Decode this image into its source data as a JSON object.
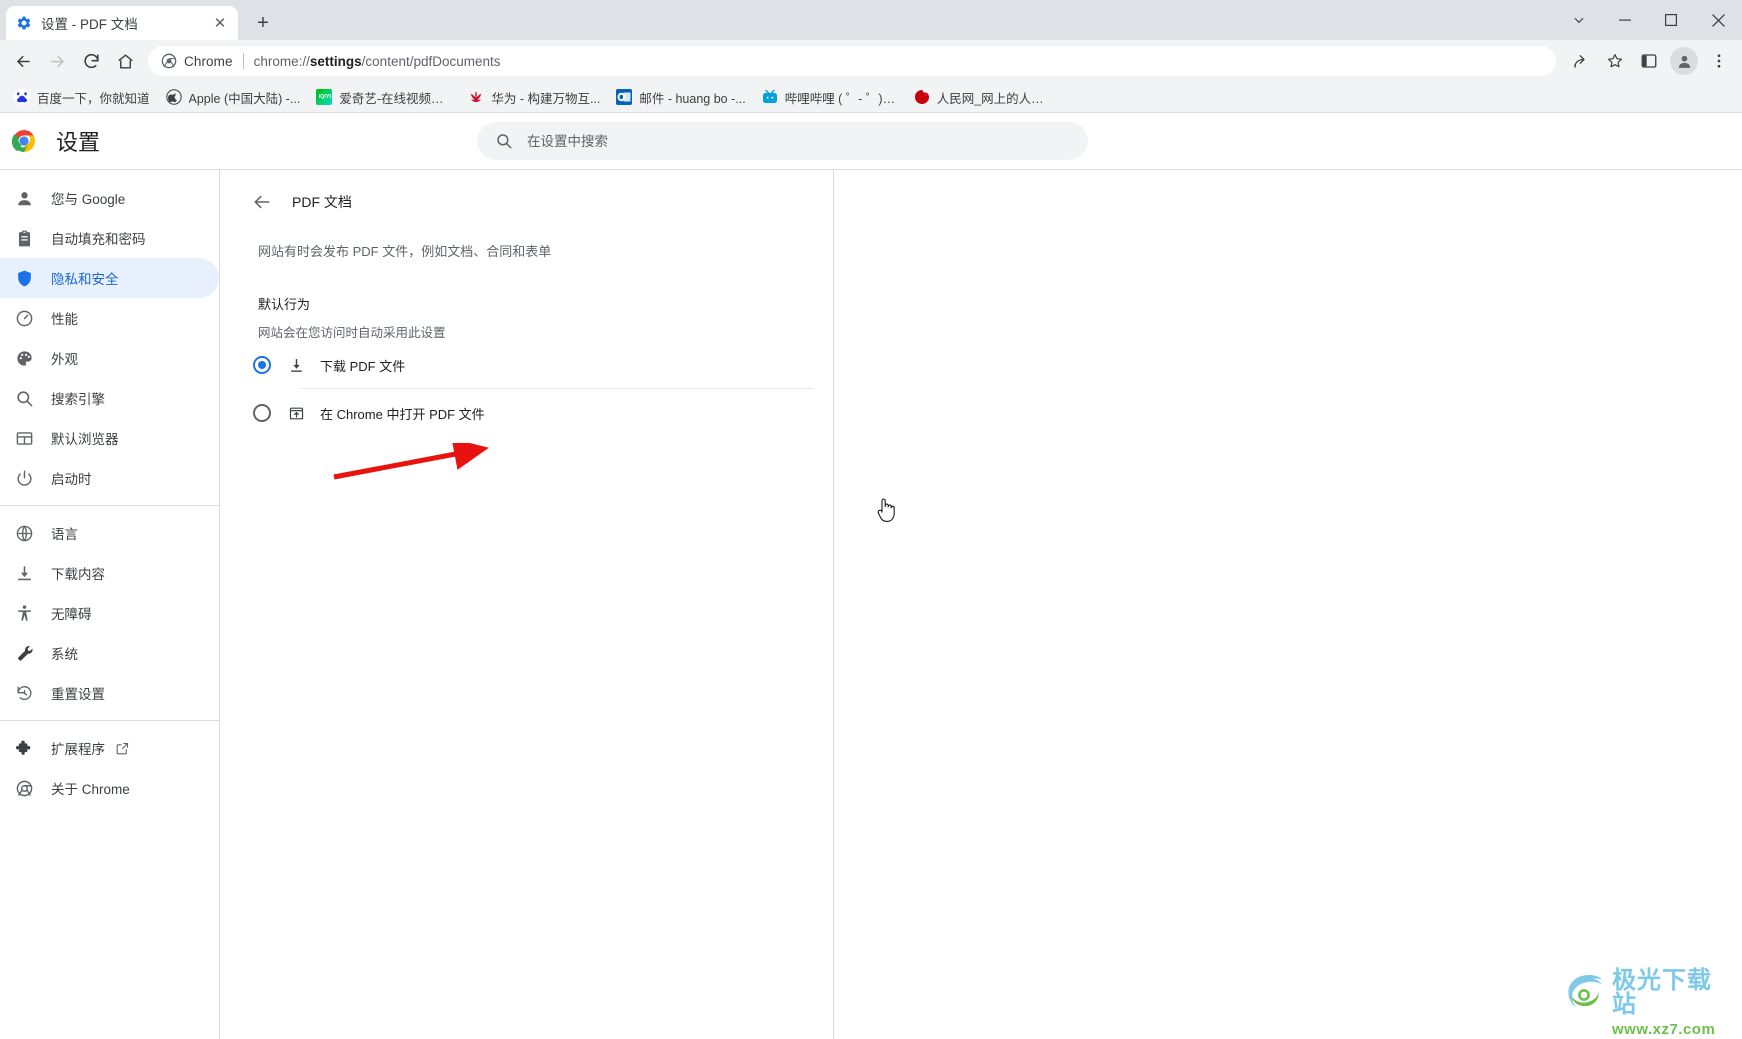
{
  "window": {
    "tab": {
      "title": "设置 - PDF 文档",
      "favicon": "gear-icon",
      "close_label": "✕"
    },
    "new_tab_label": "+",
    "controls": {
      "tab_search_label": "⌄",
      "minimize_label": "—",
      "maximize_label": "□",
      "close_label": "✕"
    }
  },
  "toolbar": {
    "back_label": "←",
    "forward_label": "→",
    "reload_label": "⟳",
    "home_label": "⌂",
    "omnibox": {
      "chip_label": "Chrome",
      "url_prefix": "chrome://",
      "url_bold": "settings",
      "url_suffix": "/content/pdfDocuments"
    },
    "share_icon": "share-icon",
    "bookmark_icon": "star-icon",
    "sidepanel_icon": "side-panel-icon",
    "profile_icon": "avatar-icon",
    "menu_icon": "three-dot-menu-icon"
  },
  "bookmarks": [
    {
      "label": "百度一下，你就知道",
      "icon": "baidu-icon",
      "glyph": "百",
      "bg": "#3385ff",
      "fg": "#ffffff"
    },
    {
      "label": "Apple (中国大陆) -...",
      "icon": "apple-icon",
      "glyph": "",
      "bg": "#555555",
      "fg": "#ffffff"
    },
    {
      "label": "爱奇艺-在线视频网...",
      "icon": "iqiyi-icon",
      "glyph": "iQIYI",
      "bg": "#00be06",
      "fg": "#ffffff"
    },
    {
      "label": "华为 - 构建万物互...",
      "icon": "huawei-icon",
      "glyph": "",
      "bg": "#ffffff",
      "fg": "#cf0a2c"
    },
    {
      "label": "邮件 - huang bo -...",
      "icon": "outlook-icon",
      "glyph": "O",
      "bg": "#0364b8",
      "fg": "#ffffff"
    },
    {
      "label": "哔哩哔哩 ( ゜- ゜)つ...",
      "icon": "bilibili-icon",
      "glyph": "",
      "bg": "#ffffff",
      "fg": "#00a1d6"
    },
    {
      "label": "人民网_网上的人民...",
      "icon": "people-icon",
      "glyph": "",
      "bg": "#ffffff",
      "fg": "#c7000b"
    }
  ],
  "settings": {
    "logo_icon": "chrome-logo-icon",
    "title": "设置",
    "search": {
      "icon": "search-icon",
      "placeholder": "在设置中搜索",
      "value": ""
    },
    "sidebar_groups": [
      {
        "items": [
          {
            "label": "您与 Google",
            "icon": "person-icon",
            "active": false
          },
          {
            "label": "自动填充和密码",
            "icon": "clipboard-icon",
            "active": false
          },
          {
            "label": "隐私和安全",
            "icon": "shield-icon",
            "active": true
          },
          {
            "label": "性能",
            "icon": "speedometer-icon",
            "active": false
          },
          {
            "label": "外观",
            "icon": "palette-icon",
            "active": false
          },
          {
            "label": "搜索引擎",
            "icon": "search-icon",
            "active": false
          },
          {
            "label": "默认浏览器",
            "icon": "browser-window-icon",
            "active": false
          },
          {
            "label": "启动时",
            "icon": "power-icon",
            "active": false
          }
        ]
      },
      {
        "items": [
          {
            "label": "语言",
            "icon": "globe-icon",
            "active": false
          },
          {
            "label": "下载内容",
            "icon": "download-icon",
            "active": false
          },
          {
            "label": "无障碍",
            "icon": "accessibility-icon",
            "active": false
          },
          {
            "label": "系统",
            "icon": "wrench-icon",
            "active": false
          },
          {
            "label": "重置设置",
            "icon": "history-restore-icon",
            "active": false
          }
        ]
      },
      {
        "items": [
          {
            "label": "扩展程序",
            "icon": "puzzle-icon",
            "active": false,
            "external": true
          },
          {
            "label": "关于 Chrome",
            "icon": "chrome-icon",
            "active": false
          }
        ]
      }
    ],
    "detail": {
      "back_icon": "back-arrow-icon",
      "title": "PDF 文档",
      "description": "网站有时会发布 PDF 文件，例如文档、合同和表单",
      "group_title": "默认行为",
      "group_subtitle": "网站会在您访问时自动采用此设置",
      "options": [
        {
          "label": "下载 PDF 文件",
          "icon": "download-icon",
          "checked": true
        },
        {
          "label": "在 Chrome 中打开 PDF 文件",
          "icon": "open-in-window-icon",
          "checked": false
        }
      ]
    }
  },
  "annotations": {
    "arrow_color": "#e8130e",
    "cursor_icon": "hand-pointer-cursor"
  },
  "watermark": {
    "title": "极光下载站",
    "url": "www.xz7.com",
    "title_color": "#7ec8e8",
    "url_color": "#6cbf4a"
  }
}
